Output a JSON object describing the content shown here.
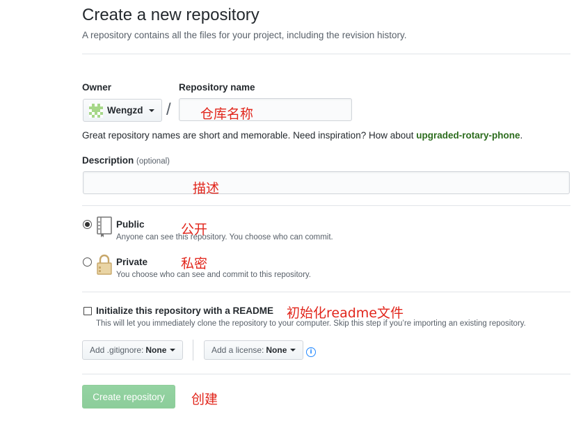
{
  "header": {
    "title": "Create a new repository",
    "subtitle": "A repository contains all the files for your project, including the revision history."
  },
  "owner": {
    "label": "Owner",
    "value": "Wengzd",
    "avatar_icon": "identicon-avatar"
  },
  "separator": "/",
  "repo_name": {
    "label": "Repository name",
    "value": "",
    "annotation": "仓库名称"
  },
  "name_hint": {
    "text": "Great repository names are short and memorable. Need inspiration? How about ",
    "suggestion": "upgraded-rotary-phone",
    "end": "."
  },
  "description": {
    "label": "Description",
    "optional": "(optional)",
    "value": "",
    "annotation": "描述"
  },
  "visibility": {
    "selected": "public",
    "public": {
      "title": "Public",
      "desc": "Anyone can see this repository. You choose who can commit.",
      "annotation": "公开",
      "icon": "repo-book-icon"
    },
    "private": {
      "title": "Private",
      "desc": "You choose who can see and commit to this repository.",
      "annotation": "私密",
      "icon": "lock-icon"
    }
  },
  "readme": {
    "checked": false,
    "title": "Initialize this repository with a README",
    "desc": "This will let you immediately clone the repository to your computer. Skip this step if you’re importing an existing repository.",
    "annotation": "初始化readme文件"
  },
  "gitignore": {
    "label": "Add .gitignore:",
    "value": "None"
  },
  "license": {
    "label": "Add a license:",
    "value": "None"
  },
  "info_icon": "i",
  "create": {
    "label": "Create repository",
    "annotation": "创建"
  },
  "colors": {
    "annotation": "#e1251b",
    "create_button": "#94d3a2",
    "suggestion": "#2c6c1d",
    "info": "#2188ff"
  }
}
